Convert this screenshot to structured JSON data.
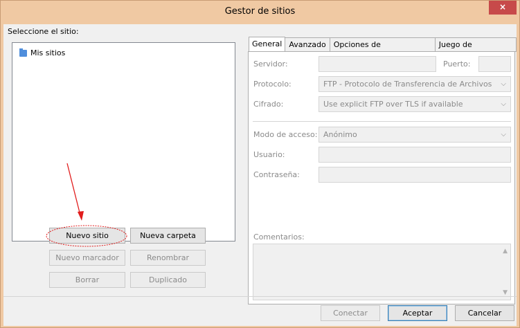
{
  "window": {
    "title": "Gestor de sitios",
    "close_glyph": "×"
  },
  "left": {
    "label": "Seleccione el sitio:",
    "tree": [
      {
        "label": "Mis sitios",
        "icon": "folder-icon"
      }
    ],
    "buttons": {
      "new_site": "Nuevo sitio",
      "new_folder": "Nueva carpeta",
      "new_bookmark": "Nuevo marcador",
      "rename": "Renombrar",
      "delete": "Borrar",
      "duplicate": "Duplicado"
    }
  },
  "tabs": [
    "General",
    "Avanzado",
    "Opciones de Transferencia",
    "Juego de caracteres"
  ],
  "general": {
    "server_label": "Servidor:",
    "port_label": "Puerto:",
    "protocol_label": "Protocolo:",
    "protocol_value": "FTP - Protocolo de Transferencia de Archivos",
    "encryption_label": "Cifrado:",
    "encryption_value": "Use explicit FTP over TLS if available",
    "access_mode_label": "Modo de acceso:",
    "access_mode_value": "Anónimo",
    "user_label": "Usuario:",
    "password_label": "Contraseña:",
    "comments_label": "Comentarios:",
    "chevron": "⌵",
    "scroll_up": "▲",
    "scroll_down": "▼"
  },
  "footer": {
    "connect": "Conectar",
    "accept": "Aceptar",
    "cancel": "Cancelar"
  },
  "colors": {
    "title_bg": "#f0c9a3",
    "close_bg": "#c74a4a",
    "annotation": "#e11d1d"
  }
}
